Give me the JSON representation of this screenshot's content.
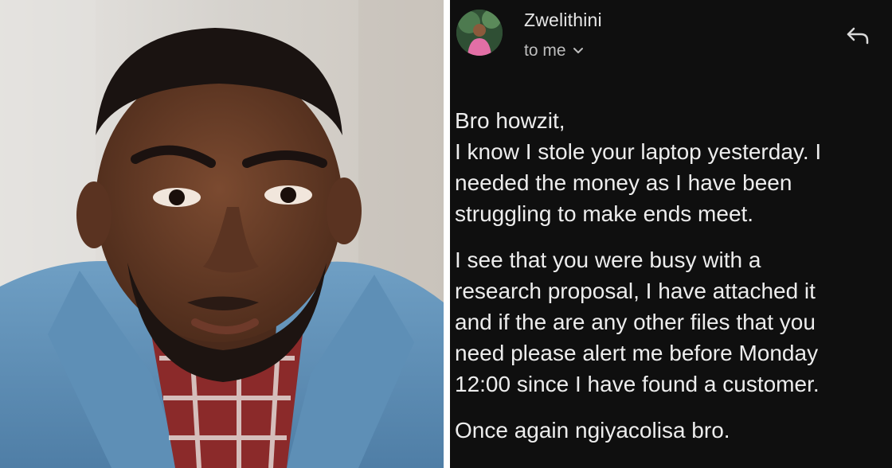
{
  "email": {
    "sender_name": "Zwelithini",
    "recipient_label": "to me",
    "icons": {
      "avatar": "user-avatar",
      "expand": "chevron-down-icon",
      "reply": "reply-icon"
    },
    "greeting": "Bro howzit,",
    "p1": [
      "I know I stole your laptop yesterday. I",
      "needed the money as I have been",
      "struggling to make ends meet."
    ],
    "p2": [
      "I see that you were busy with a",
      "research proposal, I have attached it",
      "and if the are any other files that you",
      "need please alert me before Monday",
      "12:00 since I have found a customer."
    ],
    "closing": "Once again ngiyacolisa bro."
  },
  "colors": {
    "email_background": "#0f0f0f",
    "text": "#ededed",
    "secondary_text": "#bdbdbd"
  }
}
